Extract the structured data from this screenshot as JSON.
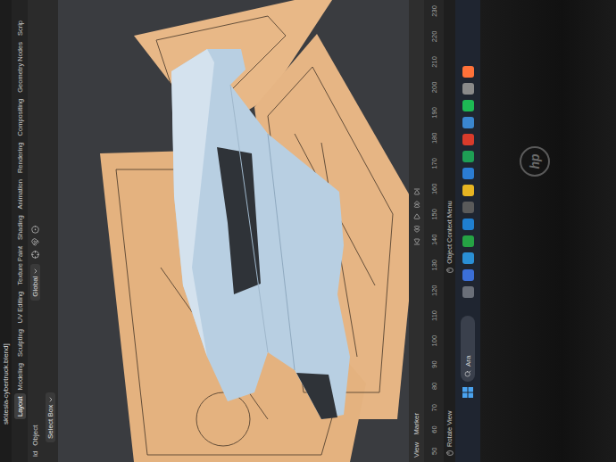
{
  "window": {
    "title": "sk\\tesla-cybertruck.blend]"
  },
  "workspace_tabs": [
    {
      "label": "Layout",
      "selected": true
    },
    {
      "label": "Modeling",
      "selected": false
    },
    {
      "label": "Sculpting",
      "selected": false
    },
    {
      "label": "UV Editing",
      "selected": false
    },
    {
      "label": "Texture Paint",
      "selected": false
    },
    {
      "label": "Shading",
      "selected": false
    },
    {
      "label": "Animation",
      "selected": false
    },
    {
      "label": "Rendering",
      "selected": false
    },
    {
      "label": "Compositing",
      "selected": false
    },
    {
      "label": "Geometry Nodes",
      "selected": false
    },
    {
      "label": "Scrip",
      "selected": false
    }
  ],
  "viewport_header": {
    "menus": [
      "ld",
      "Object"
    ],
    "orientation": "Global"
  },
  "tool_settings": {
    "tool": "Select Box"
  },
  "timeline": {
    "menus": [
      "View",
      "Marker"
    ],
    "ticks": [
      "50",
      "60",
      "70",
      "80",
      "90",
      "100",
      "110",
      "120",
      "130",
      "140",
      "150",
      "160",
      "170",
      "180",
      "190",
      "200",
      "210",
      "220",
      "230"
    ]
  },
  "status_bar": {
    "hints": [
      "Rotate View",
      "Object Context Menu"
    ]
  },
  "taskbar": {
    "search": {
      "placeholder": "Ara"
    },
    "apps": [
      {
        "color": "#6a6f78"
      },
      {
        "color": "#3b6fd8"
      },
      {
        "color": "#2a8fd6"
      },
      {
        "color": "#25a244"
      },
      {
        "color": "#1f7fd1"
      },
      {
        "color": "#5a5a5a"
      },
      {
        "color": "#e6b422"
      },
      {
        "color": "#2b7cd3"
      },
      {
        "color": "#1e9e55"
      },
      {
        "color": "#d83b2b"
      },
      {
        "color": "#3a86d0"
      },
      {
        "color": "#1db954"
      },
      {
        "color": "#8a8a8a"
      },
      {
        "color": "#ff7139"
      }
    ]
  },
  "bezel": {
    "logo": "hp"
  }
}
